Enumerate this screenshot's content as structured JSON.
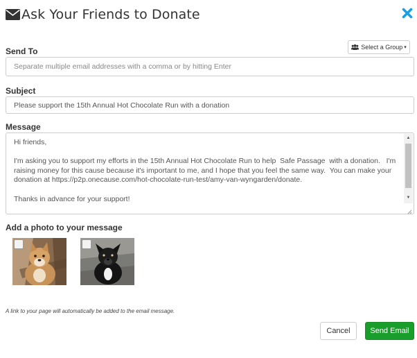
{
  "modal": {
    "title": "Ask Your Friends to Donate",
    "title_icon": "envelope-icon",
    "close_icon": "close-icon",
    "accent_color": "#1a9ee6"
  },
  "send_to": {
    "label": "Send To",
    "placeholder": "Separate multiple email addresses with a comma or by hitting Enter",
    "value": "",
    "group_button": {
      "label": "Select a Group",
      "icon": "users-icon",
      "caret": "▾"
    }
  },
  "subject": {
    "label": "Subject",
    "value": "Please support the 15th Annual Hot Chocolate Run with a donation"
  },
  "message": {
    "label": "Message",
    "paragraphs": [
      "Hi friends,",
      "I'm asking you to support my efforts in the 15th Annual Hot Chocolate Run to help  Safe Passage  with a donation.   I'm raising money for this cause because it's important to me, and I hope that you feel the same way.  You can make your donation at https://p2p.onecause.com/hot-chocolate-run-test/amy-van-wyngarden/donate.",
      "Thanks in advance for your support!"
    ]
  },
  "photos": {
    "label": "Add a photo to your message",
    "items": [
      {
        "name": "dog-photo-tan",
        "checked": false
      },
      {
        "name": "dog-photo-black",
        "checked": false
      }
    ]
  },
  "note": "A link to your page will automatically be added to the email message.",
  "actions": {
    "cancel_label": "Cancel",
    "send_label": "Send Email",
    "send_color": "#1a9e2b"
  }
}
